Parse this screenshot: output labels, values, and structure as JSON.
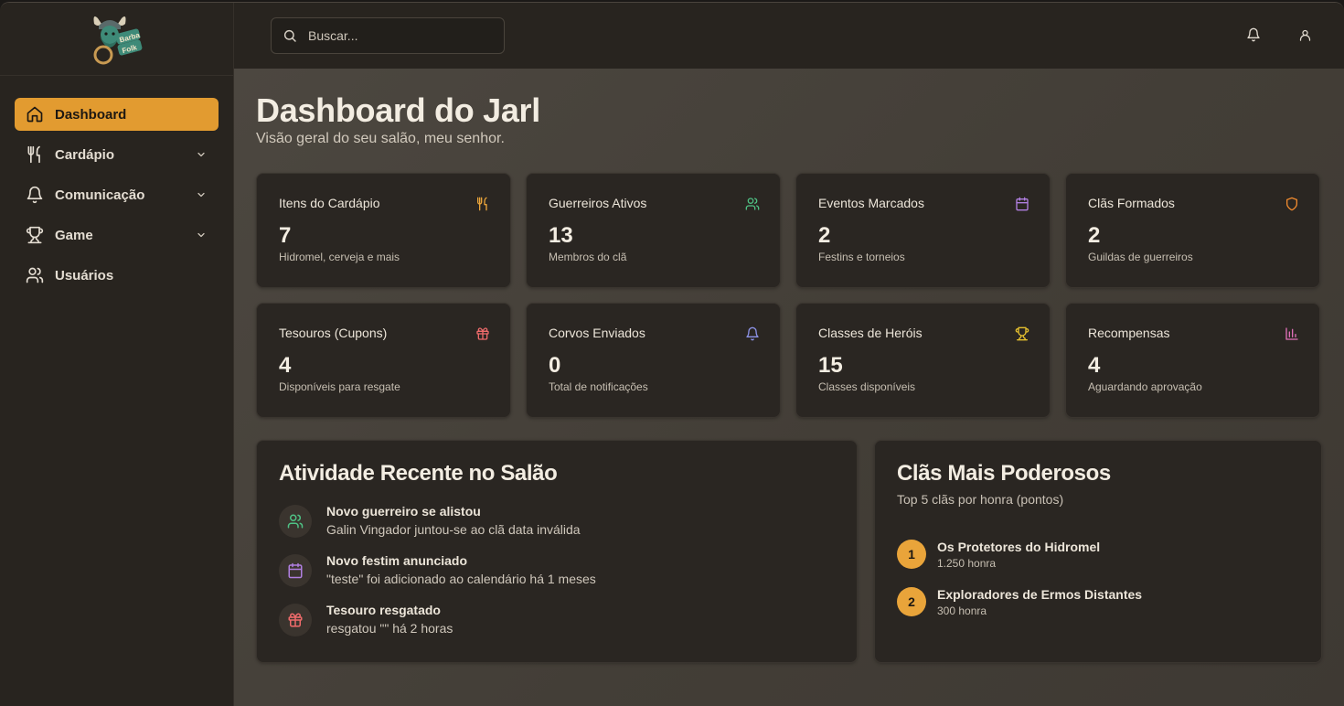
{
  "brand": {
    "logo_text": "BarbaFolk"
  },
  "sidebar": {
    "items": [
      {
        "label": "Dashboard",
        "icon": "home-icon",
        "active": true,
        "expandable": false
      },
      {
        "label": "Cardápio",
        "icon": "utensils-icon",
        "active": false,
        "expandable": true
      },
      {
        "label": "Comunicação",
        "icon": "bell-icon",
        "active": false,
        "expandable": true
      },
      {
        "label": "Game",
        "icon": "trophy-icon",
        "active": false,
        "expandable": true
      },
      {
        "label": "Usuários",
        "icon": "users-icon",
        "active": false,
        "expandable": false
      }
    ]
  },
  "header": {
    "search_placeholder": "Buscar...",
    "notifications_icon": "bell-icon",
    "profile_icon": "user-icon"
  },
  "page": {
    "title": "Dashboard do Jarl",
    "subtitle": "Visão geral do seu salão, meu senhor."
  },
  "stats": [
    {
      "title": "Itens do Cardápio",
      "value": "7",
      "desc": "Hidromel, cerveja e mais",
      "icon": "utensils-icon",
      "color": "#e9a43a"
    },
    {
      "title": "Guerreiros Ativos",
      "value": "13",
      "desc": "Membros do clã",
      "icon": "users-icon",
      "color": "#4fc285"
    },
    {
      "title": "Eventos Marcados",
      "value": "2",
      "desc": "Festins e torneios",
      "icon": "calendar-icon",
      "color": "#b07fe0"
    },
    {
      "title": "Clãs Formados",
      "value": "2",
      "desc": "Guildas de guerreiros",
      "icon": "shield-icon",
      "color": "#ef8a2f"
    },
    {
      "title": "Tesouros (Cupons)",
      "value": "4",
      "desc": "Disponíveis para resgate",
      "icon": "gift-icon",
      "color": "#ef6b6b"
    },
    {
      "title": "Corvos Enviados",
      "value": "0",
      "desc": "Total de notificações",
      "icon": "bell-icon",
      "color": "#8d93e8"
    },
    {
      "title": "Classes de Heróis",
      "value": "15",
      "desc": "Classes disponíveis",
      "icon": "trophy-icon",
      "color": "#e6c12f"
    },
    {
      "title": "Recompensas",
      "value": "4",
      "desc": "Aguardando aprovação",
      "icon": "bar-chart-icon",
      "color": "#e070b8"
    }
  ],
  "activity": {
    "title": "Atividade Recente no Salão",
    "items": [
      {
        "title": "Novo guerreiro se alistou",
        "desc": "Galin Vingador juntou-se ao clã data inválida",
        "icon": "users-icon",
        "color": "#4fc285"
      },
      {
        "title": "Novo festim anunciado",
        "desc": "\"teste\" foi adicionado ao calendário há 1 meses",
        "icon": "calendar-icon",
        "color": "#b07fe0"
      },
      {
        "title": "Tesouro resgatado",
        "desc": "resgatou \"\" há 2 horas",
        "icon": "gift-icon",
        "color": "#ef6b6b"
      }
    ]
  },
  "clans": {
    "title": "Clãs Mais Poderosos",
    "subtitle": "Top 5 clãs por honra (pontos)",
    "items": [
      {
        "rank": "1",
        "name": "Os Protetores do Hidromel",
        "score": "1.250 honra"
      },
      {
        "rank": "2",
        "name": "Exploradores de Ermos Distantes",
        "score": "300 honra"
      }
    ]
  },
  "colors": {
    "accent": "#e29b30",
    "rank_badge": "#e9a43a"
  }
}
